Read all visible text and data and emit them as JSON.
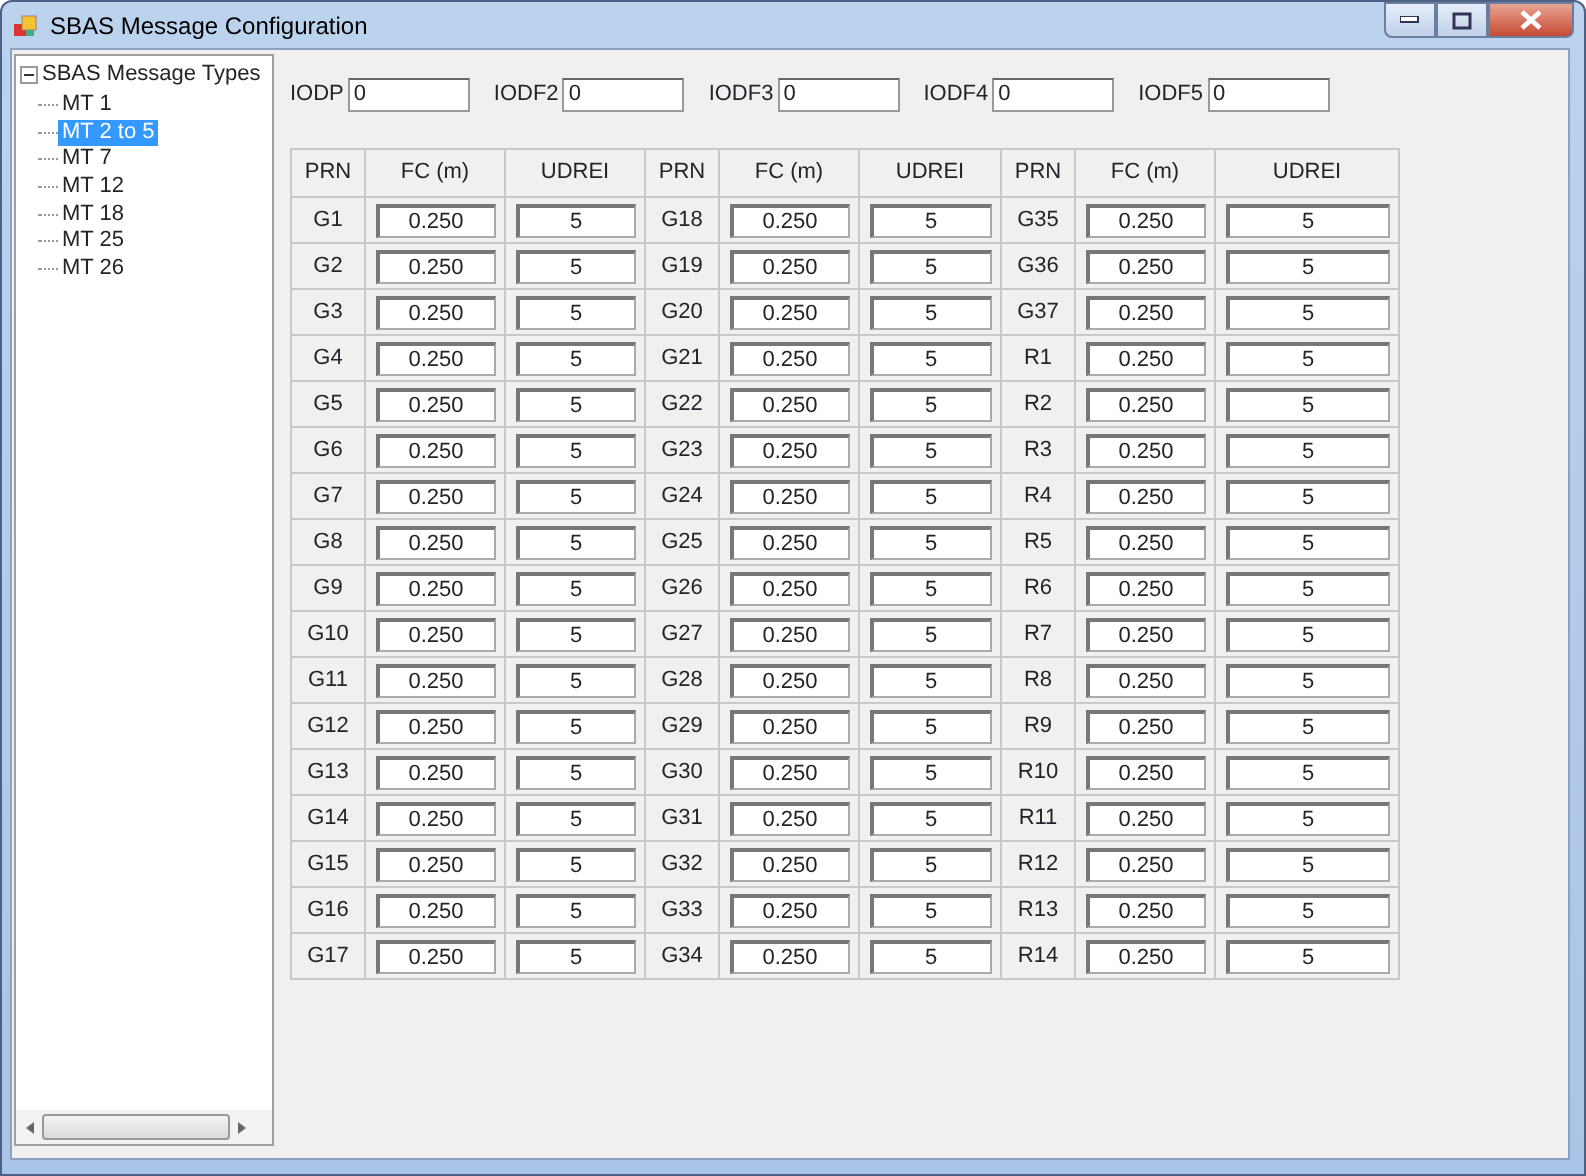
{
  "window": {
    "title": "SBAS Message Configuration"
  },
  "tree": {
    "label": "SBAS Message Types",
    "expanded": true,
    "children": [
      {
        "label": "MT 1",
        "selected": false
      },
      {
        "label": "MT 2 to 5",
        "selected": true
      },
      {
        "label": "MT 7",
        "selected": false
      },
      {
        "label": "MT 12",
        "selected": false
      },
      {
        "label": "MT 18",
        "selected": false
      },
      {
        "label": "MT 25",
        "selected": false
      },
      {
        "label": "MT 26",
        "selected": false
      }
    ]
  },
  "iod_fields": [
    {
      "label": "IODP",
      "value": "0"
    },
    {
      "label": "IODF2",
      "value": "0"
    },
    {
      "label": "IODF3",
      "value": "0"
    },
    {
      "label": "IODF4",
      "value": "0"
    },
    {
      "label": "IODF5",
      "value": "0"
    }
  ],
  "table": {
    "columns": [
      "PRN",
      "FC (m)",
      "UDREI",
      "PRN",
      "FC (m)",
      "UDREI",
      "PRN",
      "FC (m)",
      "UDREI"
    ],
    "rows": [
      [
        "G1",
        "0.250",
        "5",
        "G18",
        "0.250",
        "5",
        "G35",
        "0.250",
        "5"
      ],
      [
        "G2",
        "0.250",
        "5",
        "G19",
        "0.250",
        "5",
        "G36",
        "0.250",
        "5"
      ],
      [
        "G3",
        "0.250",
        "5",
        "G20",
        "0.250",
        "5",
        "G37",
        "0.250",
        "5"
      ],
      [
        "G4",
        "0.250",
        "5",
        "G21",
        "0.250",
        "5",
        "R1",
        "0.250",
        "5"
      ],
      [
        "G5",
        "0.250",
        "5",
        "G22",
        "0.250",
        "5",
        "R2",
        "0.250",
        "5"
      ],
      [
        "G6",
        "0.250",
        "5",
        "G23",
        "0.250",
        "5",
        "R3",
        "0.250",
        "5"
      ],
      [
        "G7",
        "0.250",
        "5",
        "G24",
        "0.250",
        "5",
        "R4",
        "0.250",
        "5"
      ],
      [
        "G8",
        "0.250",
        "5",
        "G25",
        "0.250",
        "5",
        "R5",
        "0.250",
        "5"
      ],
      [
        "G9",
        "0.250",
        "5",
        "G26",
        "0.250",
        "5",
        "R6",
        "0.250",
        "5"
      ],
      [
        "G10",
        "0.250",
        "5",
        "G27",
        "0.250",
        "5",
        "R7",
        "0.250",
        "5"
      ],
      [
        "G11",
        "0.250",
        "5",
        "G28",
        "0.250",
        "5",
        "R8",
        "0.250",
        "5"
      ],
      [
        "G12",
        "0.250",
        "5",
        "G29",
        "0.250",
        "5",
        "R9",
        "0.250",
        "5"
      ],
      [
        "G13",
        "0.250",
        "5",
        "G30",
        "0.250",
        "5",
        "R10",
        "0.250",
        "5"
      ],
      [
        "G14",
        "0.250",
        "5",
        "G31",
        "0.250",
        "5",
        "R11",
        "0.250",
        "5"
      ],
      [
        "G15",
        "0.250",
        "5",
        "G32",
        "0.250",
        "5",
        "R12",
        "0.250",
        "5"
      ],
      [
        "G16",
        "0.250",
        "5",
        "G33",
        "0.250",
        "5",
        "R13",
        "0.250",
        "5"
      ],
      [
        "G17",
        "0.250",
        "5",
        "G34",
        "0.250",
        "5",
        "R14",
        "0.250",
        "5"
      ]
    ]
  }
}
